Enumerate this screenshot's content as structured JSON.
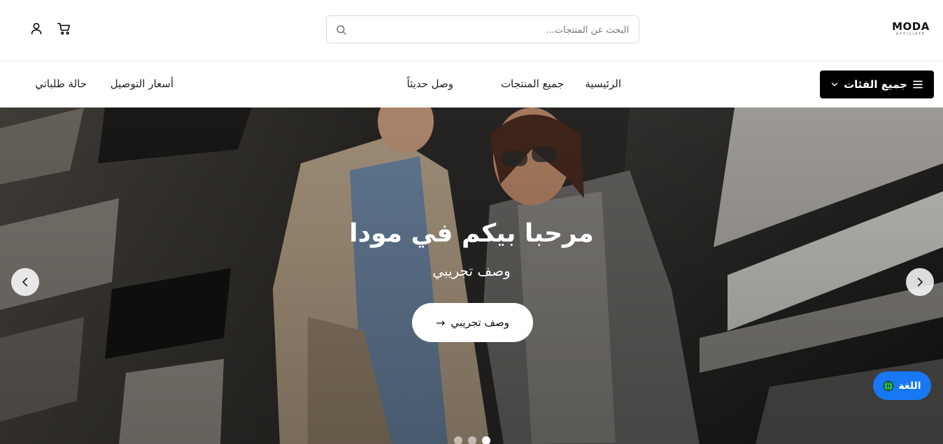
{
  "header": {
    "logo_main": "MODA",
    "logo_sub": "AFFILIATE",
    "search_placeholder": "البحث عن المنتجات...",
    "search_value": ""
  },
  "nav": {
    "categories_label": "جميع الفئات",
    "links": {
      "home": "الرئيسية",
      "all_products": "جميع المنتجات",
      "new_arrivals": "وصل حديثاً",
      "shipping_prices": "أسعار التوصيل",
      "order_status": "حالة طلباتي"
    }
  },
  "hero": {
    "title": "مرحبا بيكم في مودا",
    "subtitle": "وصف تجريبي",
    "cta_label": "وصف تجريبي",
    "cta_arrow": "→",
    "slides_count": 3,
    "active_slide": 3
  },
  "language_button": {
    "label": "اللغة"
  },
  "icons": {
    "user": "user-icon",
    "cart": "cart-icon",
    "search": "search-icon",
    "menu": "hamburger-icon",
    "chevron": "chevron-down-icon",
    "prev": "chevron-left-icon",
    "next": "chevron-right-icon",
    "globe": "globe-icon"
  },
  "colors": {
    "category_button_bg": "#000000",
    "language_button_bg": "#1877f2",
    "globe_fill": "#2ec45a"
  }
}
